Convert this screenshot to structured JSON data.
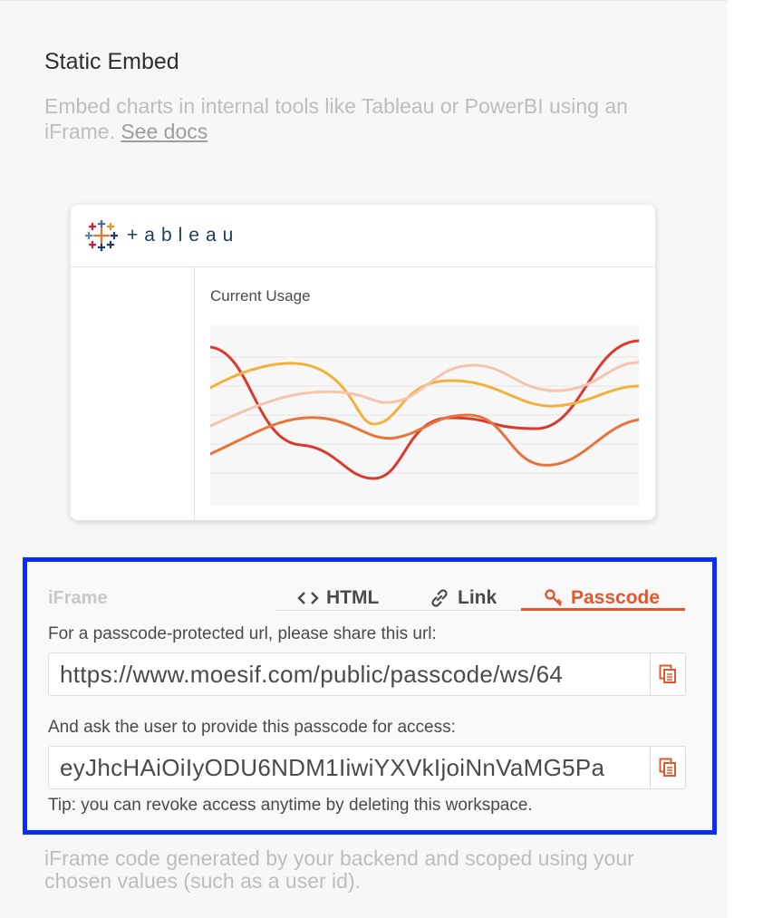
{
  "section": {
    "title": "Static Embed",
    "description": "Embed charts in internal tools like Tableau or PowerBI using an iFrame.",
    "docs_link": "See docs"
  },
  "preview": {
    "logo_text": "+ableau",
    "chart_title": "Current Usage",
    "colors": [
      "#d93a2b",
      "#f2b13c",
      "#f5c4ad",
      "#e8743b"
    ]
  },
  "embed": {
    "label": "iFrame",
    "tabs": [
      {
        "label": "HTML",
        "icon": "code-icon",
        "active": false
      },
      {
        "label": "Link",
        "icon": "link-icon",
        "active": false
      },
      {
        "label": "Passcode",
        "icon": "key-icon",
        "active": true
      }
    ],
    "url_hint": "For a passcode-protected url, please share this url:",
    "url_value": "https://www.moesif.com/public/passcode/ws/64",
    "passcode_hint": "And ask the user to provide this passcode for access:",
    "passcode_value": "eyJhcHAiOiIyODU6NDM1IiwiYXVkIjoiNnVaMG5Pa",
    "tip": "Tip: you can revoke access anytime by deleting this workspace.",
    "accent_color": "#e4572e",
    "highlight_color": "#0a2cf5"
  },
  "footer": {
    "description": "iFrame code generated by your backend and scoped using your chosen values (such as a user id)."
  }
}
